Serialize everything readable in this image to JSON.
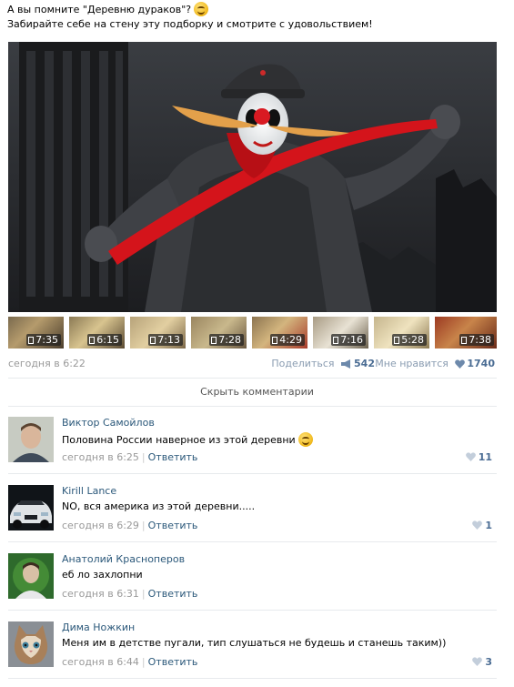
{
  "post": {
    "line1": "А вы помните \"Деревню дураков\"?",
    "line2": "Забирайте себе на стену эту подборку и смотрите с удовольствием!",
    "emoji": "smile-emoji",
    "date": "сегодня в 6:22",
    "share_label": "Поделиться",
    "share_count": "542",
    "like_label": "Мне нравится",
    "like_count": "1740"
  },
  "videos": [
    {
      "duration": "7:35"
    },
    {
      "duration": "6:15"
    },
    {
      "duration": "7:13"
    },
    {
      "duration": "7:28"
    },
    {
      "duration": "4:29"
    },
    {
      "duration": "7:16"
    },
    {
      "duration": "5:28"
    },
    {
      "duration": "7:38"
    }
  ],
  "hide_comments_label": "Скрыть комментарии",
  "reply_label": "Ответить",
  "comments": [
    {
      "author": "Виктор Самойлов",
      "text": "Половина России наверное из этой деревни",
      "time": "сегодня в 6:25",
      "likes": "11"
    },
    {
      "author": "Kirill Lance",
      "text": "NO, вся америка из этой деревни.....",
      "time": "сегодня в 6:29",
      "likes": "1"
    },
    {
      "author": "Анатолий Красноперов",
      "text": "еб ло захлопни",
      "time": "сегодня в 6:31",
      "likes": ""
    },
    {
      "author": "Дима Ножкин",
      "text": "Меня им в детстве пугали, тип слушаться не будешь и станешь таким))",
      "time": "сегодня в 6:44",
      "likes": "3"
    }
  ],
  "colors": {
    "link": "#2b587a",
    "meta": "#999999",
    "count": "#4a6c93",
    "separator": "#e7eaed"
  }
}
